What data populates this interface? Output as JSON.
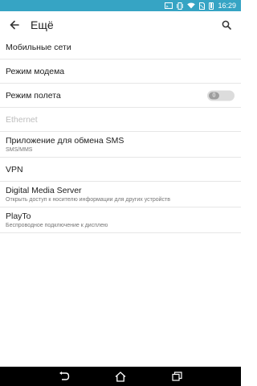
{
  "status_bar": {
    "time": "16:29"
  },
  "app_bar": {
    "title": "Ещё",
    "back_icon": "arrow-back-icon",
    "search_icon": "search-icon"
  },
  "items": [
    {
      "label": "Мобильные сети"
    },
    {
      "label": "Режим модема"
    },
    {
      "label": "Режим полета",
      "toggle": "0"
    },
    {
      "label": "Ethernet"
    },
    {
      "label": "Приложение для обмена SMS",
      "sub": "SMS/MMS"
    },
    {
      "label": "VPN"
    },
    {
      "label": "Digital Media Server",
      "sub": "Открыть доступ к носителю информации для других устройств"
    },
    {
      "label": "PlayTo",
      "sub": "Беспроводное подключение к дисплею"
    }
  ],
  "colors": {
    "status_bar": "#36a4c4",
    "nav_bar": "#000000"
  }
}
